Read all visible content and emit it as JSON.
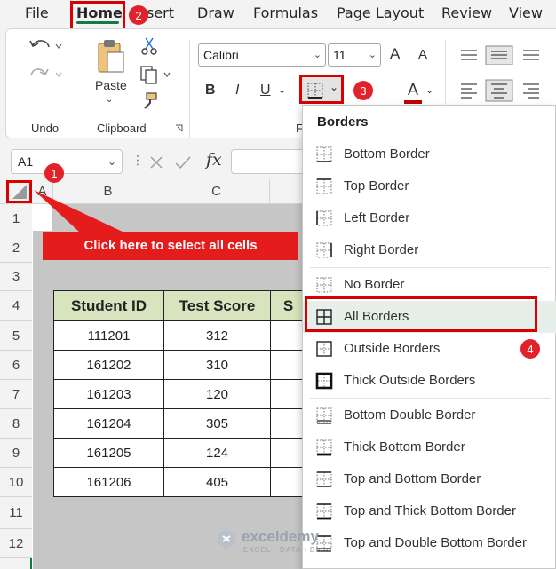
{
  "menu": {
    "items": [
      "File",
      "Home",
      "sert",
      "Draw",
      "Formulas",
      "Page Layout",
      "Review",
      "View"
    ]
  },
  "ribbon": {
    "undo_label": "Undo",
    "clipboard_label": "Clipboard",
    "paste_label": "Paste",
    "font_name": "Calibri",
    "font_size": "11",
    "bold": "B",
    "italic": "I",
    "underline": "U",
    "font_color_letter": "A",
    "font_group_label_fragment": "F",
    "grow_font": "A",
    "shrink_font": "A"
  },
  "formula_bar": {
    "name_box": "A1",
    "fx": "fx"
  },
  "grid": {
    "columns": [
      "A",
      "B",
      "C"
    ],
    "rows": [
      "1",
      "2",
      "3",
      "4",
      "5",
      "6",
      "7",
      "8",
      "9",
      "10",
      "11",
      "12"
    ]
  },
  "table": {
    "headers": [
      "Student ID",
      "Test Score",
      "S"
    ],
    "rows": [
      [
        "111201",
        "312"
      ],
      [
        "161202",
        "310"
      ],
      [
        "161203",
        "120"
      ],
      [
        "161204",
        "305"
      ],
      [
        "161205",
        "124"
      ],
      [
        "161206",
        "405"
      ]
    ]
  },
  "annotations": {
    "callout": "Click here to select all cells",
    "badge1": "1",
    "badge2": "2",
    "badge3": "3",
    "badge4": "4"
  },
  "borders_menu": {
    "title": "Borders",
    "items": [
      "Bottom Border",
      "Top Border",
      "Left Border",
      "Right Border",
      "No Border",
      "All Borders",
      "Outside Borders",
      "Thick Outside Borders",
      "Bottom Double Border",
      "Thick Bottom Border",
      "Top and Bottom Border",
      "Top and Thick Bottom Border",
      "Top and Double Bottom Border"
    ]
  },
  "watermark": {
    "brand": "exceldemy",
    "tagline": "EXCEL · DATA · BI"
  },
  "colors": {
    "accent_green": "#107c41",
    "annotation_red": "#e2222b",
    "header_fill": "#d7e4bd",
    "highlight": "#e6efe9"
  }
}
